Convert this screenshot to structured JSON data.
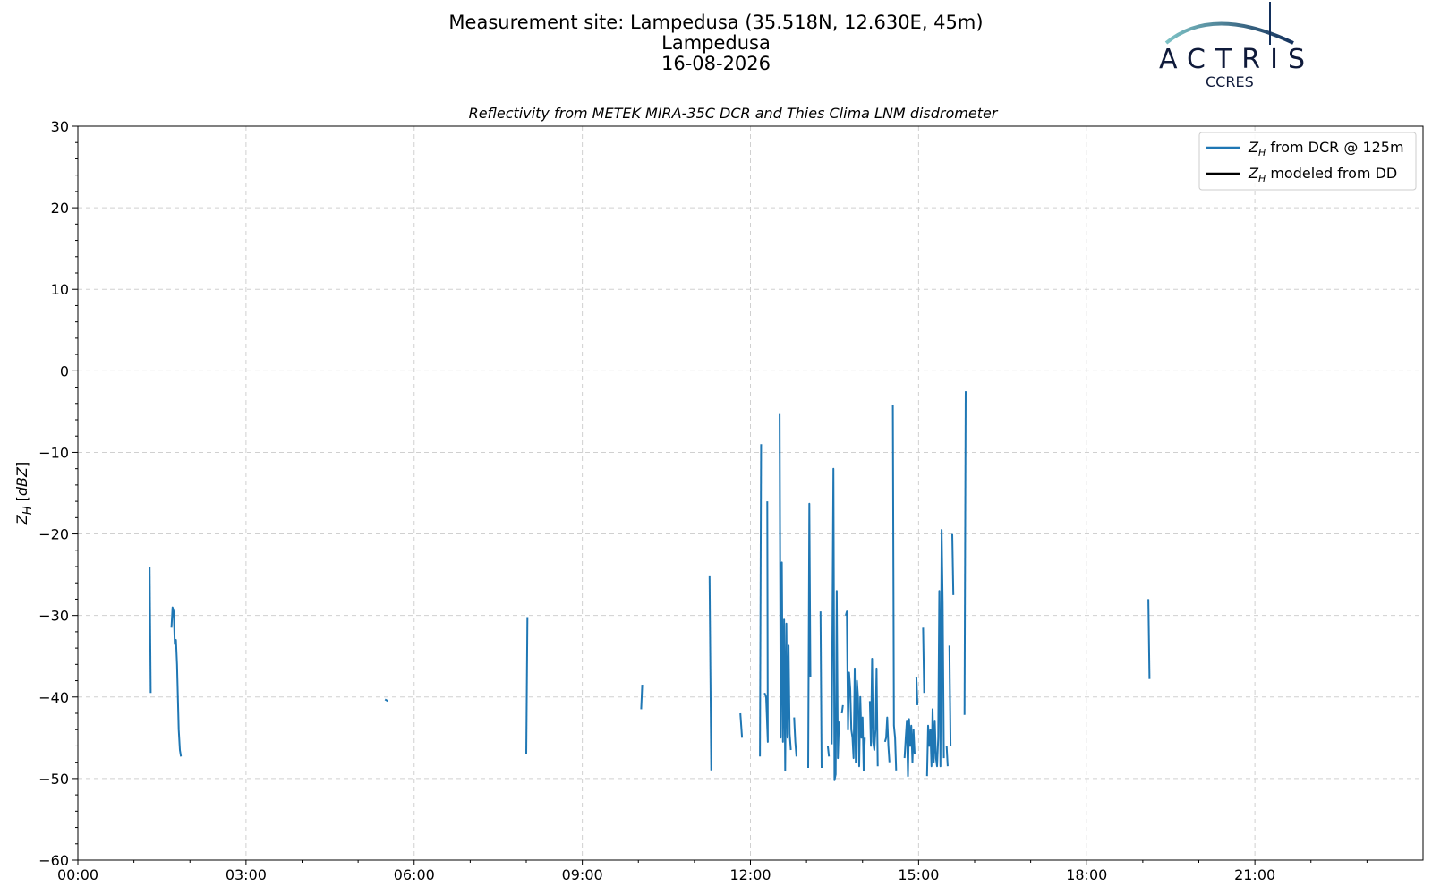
{
  "header": {
    "line1": "Measurement site: Lampedusa (35.518N, 12.630E, 45m)",
    "line2": "Lampedusa",
    "line3": "16-08-2026"
  },
  "logo": {
    "text": "ACTRIS",
    "subtext": "CCRES",
    "colors": {
      "arc_start": "#7ec3c6",
      "arc_end": "#13305c",
      "text": "#0f1a3a"
    }
  },
  "chart_data": {
    "type": "line",
    "title": "Reflectivity from METEK MIRA-35C DCR and Thies Clima LNM disdrometer",
    "xlabel": "",
    "ylabel": "Z_H [dBZ]",
    "xlim": [
      0,
      24
    ],
    "ylim": [
      -60,
      30
    ],
    "grid": true,
    "legend_position": "top-right",
    "xticks": [
      {
        "v": 0,
        "label": "00:00"
      },
      {
        "v": 3,
        "label": "03:00"
      },
      {
        "v": 6,
        "label": "06:00"
      },
      {
        "v": 9,
        "label": "09:00"
      },
      {
        "v": 12,
        "label": "12:00"
      },
      {
        "v": 15,
        "label": "15:00"
      },
      {
        "v": 18,
        "label": "18:00"
      },
      {
        "v": 21,
        "label": "21:00"
      }
    ],
    "yticks": [
      30,
      20,
      10,
      0,
      -10,
      -20,
      -30,
      -40,
      -50,
      -60
    ],
    "series": [
      {
        "name": "Z_H from DCR @ 125m",
        "color": "#1f77b4",
        "segments": [
          [
            [
              1.28,
              -24
            ],
            [
              1.3,
              -39.5
            ]
          ],
          [
            [
              1.67,
              -31.5
            ],
            [
              1.69,
              -29
            ],
            [
              1.71,
              -29.5
            ],
            [
              1.73,
              -33.5
            ],
            [
              1.75,
              -33
            ],
            [
              1.77,
              -36
            ],
            [
              1.8,
              -44
            ],
            [
              1.82,
              -46.5
            ],
            [
              1.84,
              -47.3
            ]
          ],
          [
            [
              5.48,
              -40.3
            ],
            [
              5.53,
              -40.5
            ]
          ],
          [
            [
              8.0,
              -47
            ],
            [
              8.02,
              -30.2
            ]
          ],
          [
            [
              10.05,
              -41.5
            ],
            [
              10.07,
              -38.5
            ]
          ],
          [
            [
              11.27,
              -25.2
            ],
            [
              11.3,
              -49
            ]
          ],
          [
            [
              11.82,
              -42
            ],
            [
              11.85,
              -45
            ]
          ],
          [
            [
              12.17,
              -47.3
            ],
            [
              12.19,
              -9
            ]
          ],
          [
            [
              12.25,
              -39.5
            ],
            [
              12.28,
              -40
            ],
            [
              12.31,
              -45.5
            ],
            [
              12.3,
              -16
            ]
          ],
          [
            [
              12.52,
              -5.3
            ],
            [
              12.54,
              -45
            ],
            [
              12.56,
              -23.5
            ],
            [
              12.58,
              -45.5
            ],
            [
              12.6,
              -30.5
            ],
            [
              12.62,
              -49
            ],
            [
              12.64,
              -31
            ],
            [
              12.66,
              -45
            ],
            [
              12.68,
              -33.7
            ],
            [
              12.7,
              -44.5
            ],
            [
              12.72,
              -46.5
            ]
          ],
          [
            [
              12.78,
              -42.5
            ],
            [
              12.8,
              -45.5
            ],
            [
              12.82,
              -47.3
            ]
          ],
          [
            [
              13.03,
              -48.7
            ],
            [
              13.05,
              -16.3
            ],
            [
              13.07,
              -37.5
            ]
          ],
          [
            [
              13.25,
              -29.5
            ],
            [
              13.27,
              -48.7
            ]
          ],
          [
            [
              13.38,
              -46
            ],
            [
              13.4,
              -47.3
            ]
          ],
          [
            [
              13.45,
              -45.8
            ],
            [
              13.48,
              -12
            ],
            [
              13.5,
              -50.2
            ],
            [
              13.52,
              -49.5
            ],
            [
              13.54,
              -27
            ],
            [
              13.56,
              -47.5
            ],
            [
              13.58,
              -43
            ]
          ],
          [
            [
              13.63,
              -42
            ],
            [
              13.65,
              -41
            ]
          ],
          [
            [
              13.7,
              -30
            ],
            [
              13.72,
              -29.5
            ],
            [
              13.74,
              -44
            ],
            [
              13.76,
              -37
            ],
            [
              13.78,
              -39
            ],
            [
              13.8,
              -44
            ],
            [
              13.82,
              -45
            ],
            [
              13.84,
              -47.5
            ],
            [
              13.86,
              -36.5
            ],
            [
              13.88,
              -48
            ],
            [
              13.9,
              -38
            ],
            [
              13.92,
              -40
            ],
            [
              13.94,
              -48.5
            ],
            [
              13.96,
              -40
            ],
            [
              13.98,
              -45
            ],
            [
              14.0,
              -42.5
            ],
            [
              14.02,
              -49
            ],
            [
              14.04,
              -45
            ]
          ],
          [
            [
              14.13,
              -40.5
            ],
            [
              14.15,
              -46
            ],
            [
              14.17,
              -35.3
            ],
            [
              14.19,
              -45.5
            ],
            [
              14.21,
              -46.5
            ],
            [
              14.23,
              -44
            ],
            [
              14.25,
              -36.5
            ],
            [
              14.27,
              -48.5
            ]
          ],
          [
            [
              14.4,
              -45.5
            ],
            [
              14.42,
              -45
            ],
            [
              14.44,
              -42.5
            ],
            [
              14.46,
              -46
            ],
            [
              14.48,
              -48
            ]
          ],
          [
            [
              14.54,
              -4.2
            ],
            [
              14.56,
              -43.5
            ],
            [
              14.58,
              -45
            ],
            [
              14.6,
              -49
            ]
          ],
          [
            [
              14.75,
              -47.5
            ],
            [
              14.77,
              -45
            ],
            [
              14.79,
              -43
            ],
            [
              14.81,
              -49.7
            ],
            [
              14.83,
              -42.7
            ],
            [
              14.85,
              -46
            ],
            [
              14.87,
              -43.5
            ],
            [
              14.89,
              -48
            ],
            [
              14.91,
              -44
            ],
            [
              14.93,
              -47
            ]
          ],
          [
            [
              14.96,
              -37.5
            ],
            [
              14.98,
              -41
            ]
          ],
          [
            [
              15.08,
              -31.5
            ],
            [
              15.1,
              -39.5
            ]
          ],
          [
            [
              15.15,
              -49.7
            ],
            [
              15.17,
              -43.5
            ],
            [
              15.19,
              -46
            ],
            [
              15.21,
              -44
            ],
            [
              15.23,
              -48.5
            ],
            [
              15.25,
              -41.5
            ],
            [
              15.27,
              -48
            ],
            [
              15.29,
              -43
            ],
            [
              15.31,
              -47.5
            ],
            [
              15.33,
              -48.5
            ],
            [
              15.35,
              -45
            ],
            [
              15.37,
              -27
            ],
            [
              15.39,
              -48.5
            ],
            [
              15.41,
              -19.5
            ],
            [
              15.43,
              -28.5
            ],
            [
              15.45,
              -47.5
            ]
          ],
          [
            [
              15.5,
              -46
            ],
            [
              15.52,
              -48.5
            ]
          ],
          [
            [
              15.55,
              -33.7
            ],
            [
              15.57,
              -46
            ]
          ],
          [
            [
              15.6,
              -20
            ],
            [
              15.62,
              -27.5
            ]
          ],
          [
            [
              15.82,
              -42.2
            ],
            [
              15.84,
              -2.5
            ]
          ],
          [
            [
              19.1,
              -28
            ],
            [
              19.12,
              -37.8
            ]
          ]
        ]
      },
      {
        "name": "Z_H modeled from DD",
        "color": "#000000",
        "segments": []
      }
    ]
  }
}
